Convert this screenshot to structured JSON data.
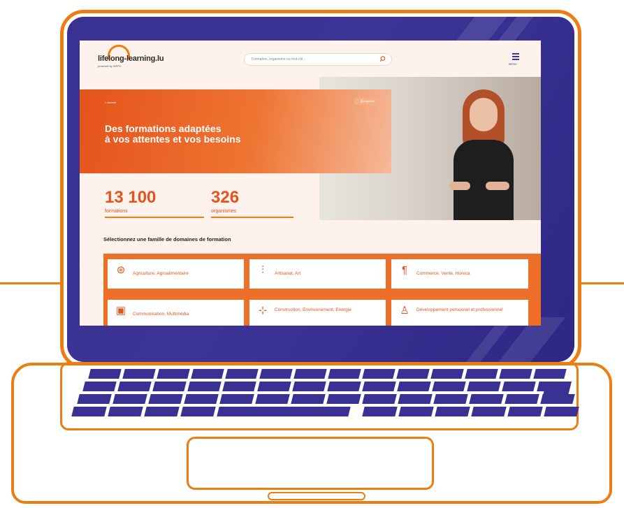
{
  "colors": {
    "brand_orange": "#ee7d11",
    "hero_orange": "#e5531b",
    "bezel_blue": "#3a3292",
    "page_bg": "#fdf3ec"
  },
  "header": {
    "logo_text": "lifelong-learning.lu",
    "logo_sub": "powered by INFPC",
    "search_placeholder": "Formation, organisme ou mot-clé...",
    "search_icon": "search-icon",
    "menu_icon": "menu-icon",
    "menu_label": "MENU"
  },
  "hero": {
    "breadcrumb": "Accueil",
    "pill_label": "Imprimer",
    "title_line1": "Des formations adaptées",
    "title_line2": "à vos attentes et vos besoins"
  },
  "stats": [
    {
      "value": "13 100",
      "label": "formations"
    },
    {
      "value": "326",
      "label": "organismes"
    }
  ],
  "section_title": "Sélectionnez une famille de domaines de formation",
  "domains": [
    {
      "label": "Agriculture, Agroalimentaire",
      "icon": "wheat-icon",
      "glyph": "⊛"
    },
    {
      "label": "Artisanat, Art",
      "icon": "tools-icon",
      "glyph": "⫶"
    },
    {
      "label": "Commerce, Vente, Horeca",
      "icon": "utensils-icon",
      "glyph": "¶"
    },
    {
      "label": "Communication, Multimédia",
      "icon": "screen-play-icon",
      "glyph": "▣"
    },
    {
      "label": "Construction, Environnement, Energie",
      "icon": "wind-turbine-icon",
      "glyph": "⊹"
    },
    {
      "label": "Développement personnel et professionnel",
      "icon": "person-growth-icon",
      "glyph": "♙"
    }
  ]
}
